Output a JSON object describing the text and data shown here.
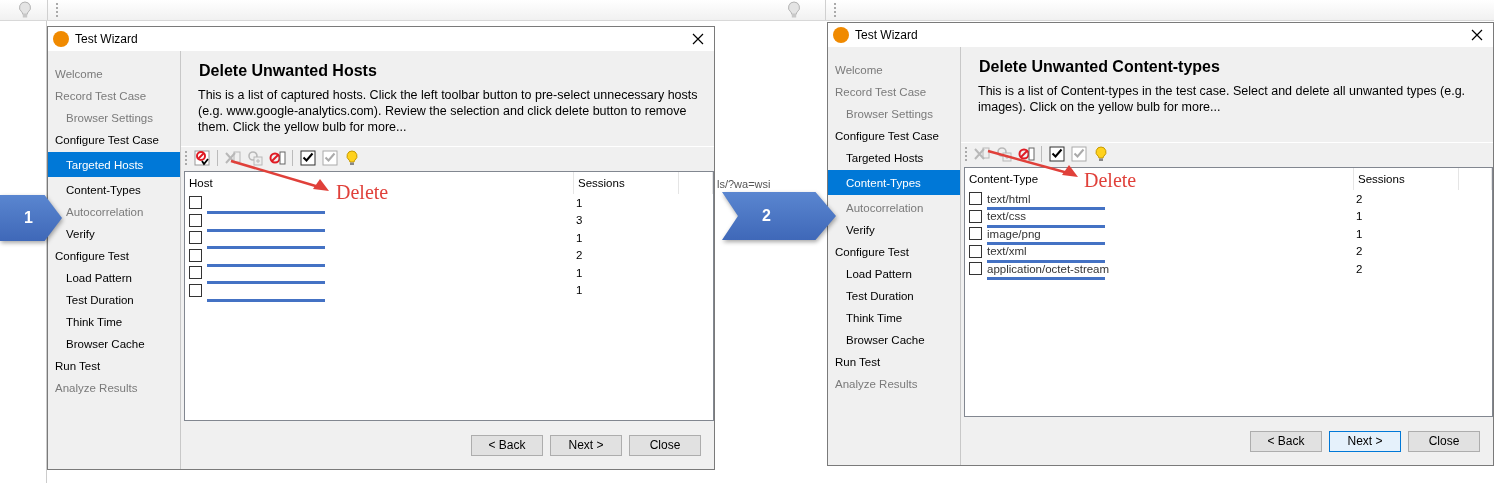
{
  "background": {
    "url_fragment": "ls/?wa=wsi"
  },
  "steps": [
    {
      "label": "1"
    },
    {
      "label": "2"
    }
  ],
  "windows": [
    {
      "title": "Test Wizard",
      "heading": "Delete Unwanted Hosts",
      "description": "This is a list of captured hosts. Click the left toolbar button to pre-select unnecessary hosts (e.g. www.google-analytics.com). Review the selection and click delete button to remove them. Click the yellow bulb for more...",
      "sidebar": [
        {
          "label": "Welcome",
          "disabled": true,
          "selected": false
        },
        {
          "label": "Record Test Case",
          "disabled": true,
          "selected": false,
          "children": [
            {
              "label": "Browser Settings",
              "disabled": true,
              "selected": false
            }
          ]
        },
        {
          "label": "Configure Test Case",
          "disabled": false,
          "selected": false,
          "children": [
            {
              "label": "Targeted Hosts",
              "disabled": false,
              "selected": true
            },
            {
              "label": "Content-Types",
              "disabled": false,
              "selected": false
            },
            {
              "label": "Autocorrelation",
              "disabled": true,
              "selected": false
            },
            {
              "label": "Verify",
              "disabled": false,
              "selected": false
            }
          ]
        },
        {
          "label": "Configure Test",
          "disabled": false,
          "selected": false,
          "children": [
            {
              "label": "Load Pattern",
              "disabled": false,
              "selected": false
            },
            {
              "label": "Test Duration",
              "disabled": false,
              "selected": false
            },
            {
              "label": "Think Time",
              "disabled": false,
              "selected": false
            },
            {
              "label": "Browser Cache",
              "disabled": false,
              "selected": false
            }
          ]
        },
        {
          "label": "Run Test",
          "disabled": false,
          "selected": false
        },
        {
          "label": "Analyze Results",
          "disabled": true,
          "selected": false
        }
      ],
      "toolbar": [
        {
          "kind": "preselect",
          "disabled": false
        },
        {
          "kind": "delete",
          "disabled": true
        },
        {
          "kind": "add",
          "disabled": true
        },
        {
          "kind": "block",
          "disabled": false
        },
        {
          "kind": "check-all",
          "disabled": false
        },
        {
          "kind": "check-all",
          "disabled": true
        },
        {
          "kind": "hint",
          "disabled": false
        }
      ],
      "annotation": "Delete",
      "table": {
        "columns": [
          "Host",
          "Sessions"
        ],
        "rows": [
          {
            "checked": false,
            "sessions": "1"
          },
          {
            "checked": false,
            "sessions": "3"
          },
          {
            "checked": false,
            "sessions": "1"
          },
          {
            "checked": false,
            "sessions": "2"
          },
          {
            "checked": false,
            "sessions": "1"
          },
          {
            "checked": false,
            "sessions": "1"
          }
        ]
      },
      "buttons": [
        {
          "label": "< Back",
          "default": false
        },
        {
          "label": "Next >",
          "default": false
        },
        {
          "label": "Close",
          "default": false
        }
      ]
    },
    {
      "title": "Test Wizard",
      "heading": "Delete Unwanted Content-types",
      "description": "This is a list of Content-types in the test case. Select and delete all unwanted types (e.g. images). Click on the yellow bulb for more...",
      "sidebar": [
        {
          "label": "Welcome",
          "disabled": true,
          "selected": false
        },
        {
          "label": "Record Test Case",
          "disabled": true,
          "selected": false,
          "children": [
            {
              "label": "Browser Settings",
              "disabled": true,
              "selected": false
            }
          ]
        },
        {
          "label": "Configure Test Case",
          "disabled": false,
          "selected": false,
          "children": [
            {
              "label": "Targeted Hosts",
              "disabled": false,
              "selected": false
            },
            {
              "label": "Content-Types",
              "disabled": false,
              "selected": true
            },
            {
              "label": "Autocorrelation",
              "disabled": true,
              "selected": false
            },
            {
              "label": "Verify",
              "disabled": false,
              "selected": false
            }
          ]
        },
        {
          "label": "Configure Test",
          "disabled": false,
          "selected": false,
          "children": [
            {
              "label": "Load Pattern",
              "disabled": false,
              "selected": false
            },
            {
              "label": "Test Duration",
              "disabled": false,
              "selected": false
            },
            {
              "label": "Think Time",
              "disabled": false,
              "selected": false
            },
            {
              "label": "Browser Cache",
              "disabled": false,
              "selected": false
            }
          ]
        },
        {
          "label": "Run Test",
          "disabled": false,
          "selected": false
        },
        {
          "label": "Analyze Results",
          "disabled": true,
          "selected": false
        }
      ],
      "toolbar": [
        {
          "kind": "delete",
          "disabled": true
        },
        {
          "kind": "add",
          "disabled": true
        },
        {
          "kind": "block",
          "disabled": false
        },
        {
          "kind": "check-all",
          "disabled": false
        },
        {
          "kind": "check-all",
          "disabled": true
        },
        {
          "kind": "hint",
          "disabled": false
        }
      ],
      "annotation": "Delete",
      "table": {
        "columns": [
          "Content-Type",
          "Sessions"
        ],
        "rows": [
          {
            "checked": false,
            "value": "text/html",
            "sessions": "2"
          },
          {
            "checked": false,
            "value": "text/css",
            "sessions": "1"
          },
          {
            "checked": false,
            "value": "image/png",
            "sessions": "1"
          },
          {
            "checked": false,
            "value": "text/xml",
            "sessions": "2"
          },
          {
            "checked": false,
            "value": "application/octet-stream",
            "sessions": "2"
          }
        ]
      },
      "buttons": [
        {
          "label": "< Back",
          "default": false
        },
        {
          "label": "Next >",
          "default": true
        },
        {
          "label": "Close",
          "default": false
        }
      ]
    }
  ]
}
